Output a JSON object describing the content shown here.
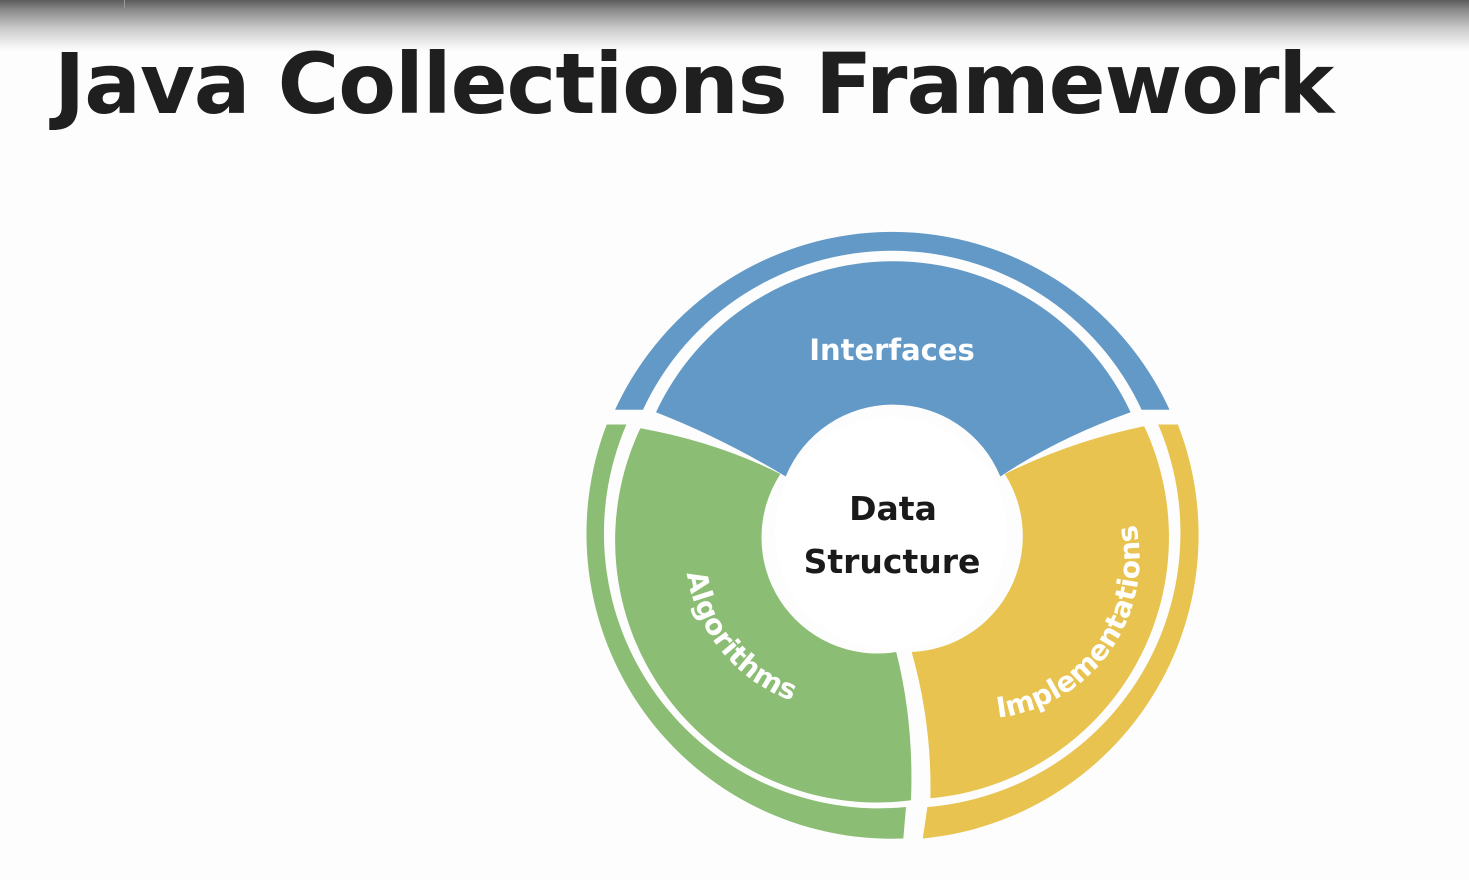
{
  "slide": {
    "title": "Java Collections Framework"
  },
  "diagram": {
    "center": {
      "line1": "Data",
      "line2": "Structure"
    },
    "segments": [
      {
        "key": "interfaces",
        "label": "Interfaces",
        "color": "#6299c7"
      },
      {
        "key": "implementations",
        "label": "Implementations",
        "color": "#e8c34f"
      },
      {
        "key": "algorithms",
        "label": "Algorithms",
        "color": "#8bbd74"
      }
    ]
  }
}
